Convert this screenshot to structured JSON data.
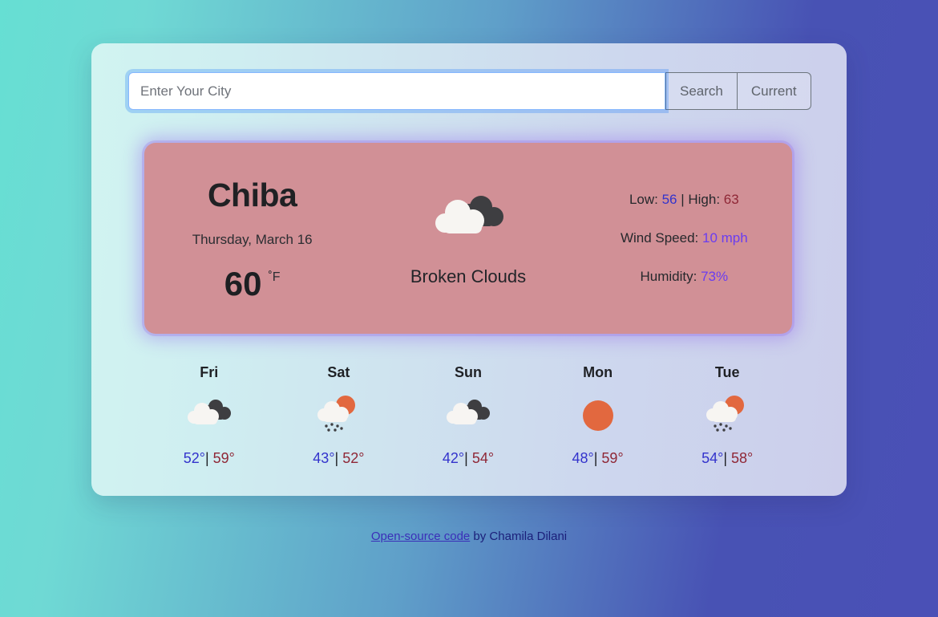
{
  "theme": {
    "bg_left": "#66dfd3",
    "bg_right": "#4852b4",
    "card_left": "#d1f4f1",
    "card_right": "#ccceeb",
    "current_card_bg": "#d19096",
    "glow": "#966eeb",
    "low_color": "#3333cc",
    "high_color": "#8f2736",
    "accent_color": "#6a3df0",
    "sun_color": "#e2683f",
    "cloud_light": "#f7f5f2",
    "cloud_dark": "#3e3e41"
  },
  "search": {
    "placeholder": "Enter Your City",
    "value": "",
    "search_label": "Search",
    "current_label": "Current"
  },
  "current": {
    "city": "Chiba",
    "date": "Thursday, March 16",
    "temp": "60",
    "unit": "˚F",
    "icon": "broken-clouds-icon",
    "description": "Broken Clouds",
    "stats": [
      {
        "name": "low-high",
        "prefix": "Low: ",
        "low": "56",
        "middle": " | High: ",
        "high": "63",
        "suffix": ""
      },
      {
        "name": "wind-speed",
        "prefix": "Wind Speed: ",
        "value": "10 mph"
      },
      {
        "name": "humidity",
        "prefix": "Humidity: ",
        "value": "73%"
      }
    ]
  },
  "forecast": [
    {
      "day": "Fri",
      "icon": "broken-clouds-icon",
      "low": "52°",
      "sep": "|",
      "high": "59°"
    },
    {
      "day": "Sat",
      "icon": "sun-rain-icon",
      "low": "43°",
      "sep": "|",
      "high": "52°"
    },
    {
      "day": "Sun",
      "icon": "broken-clouds-icon",
      "low": "42°",
      "sep": "|",
      "high": "54°"
    },
    {
      "day": "Mon",
      "icon": "sun-icon",
      "low": "48°",
      "sep": "|",
      "high": "59°"
    },
    {
      "day": "Tue",
      "icon": "sun-rain-icon",
      "low": "54°",
      "sep": "|",
      "high": "58°"
    }
  ],
  "footer": {
    "link_text": "Open-source code",
    "tail_text": " by Chamila Dilani"
  }
}
